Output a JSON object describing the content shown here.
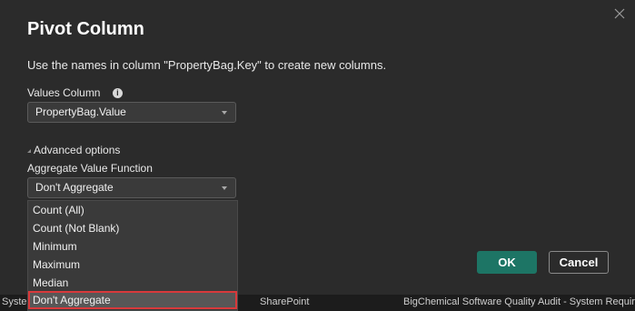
{
  "dialog": {
    "title": "Pivot Column",
    "description": "Use the names in column \"PropertyBag.Key\" to create new columns.",
    "close_icon": "close-icon"
  },
  "values_column": {
    "label": "Values Column",
    "info_icon": "info-icon",
    "selected": "PropertyBag.Value"
  },
  "advanced": {
    "label": "Advanced options",
    "aggregate_label": "Aggregate Value Function",
    "selected": "Don't Aggregate",
    "options": [
      "Count (All)",
      "Count (Not Blank)",
      "Minimum",
      "Maximum",
      "Median",
      "Don't Aggregate"
    ]
  },
  "buttons": {
    "ok": "OK",
    "cancel": "Cancel"
  },
  "background_grid": {
    "cells": [
      "Syste",
      "SharePoint",
      "BigChemical Software Quality Audit - System Require"
    ]
  },
  "colors": {
    "accent": "#1d7565",
    "highlight": "#d8393b"
  }
}
